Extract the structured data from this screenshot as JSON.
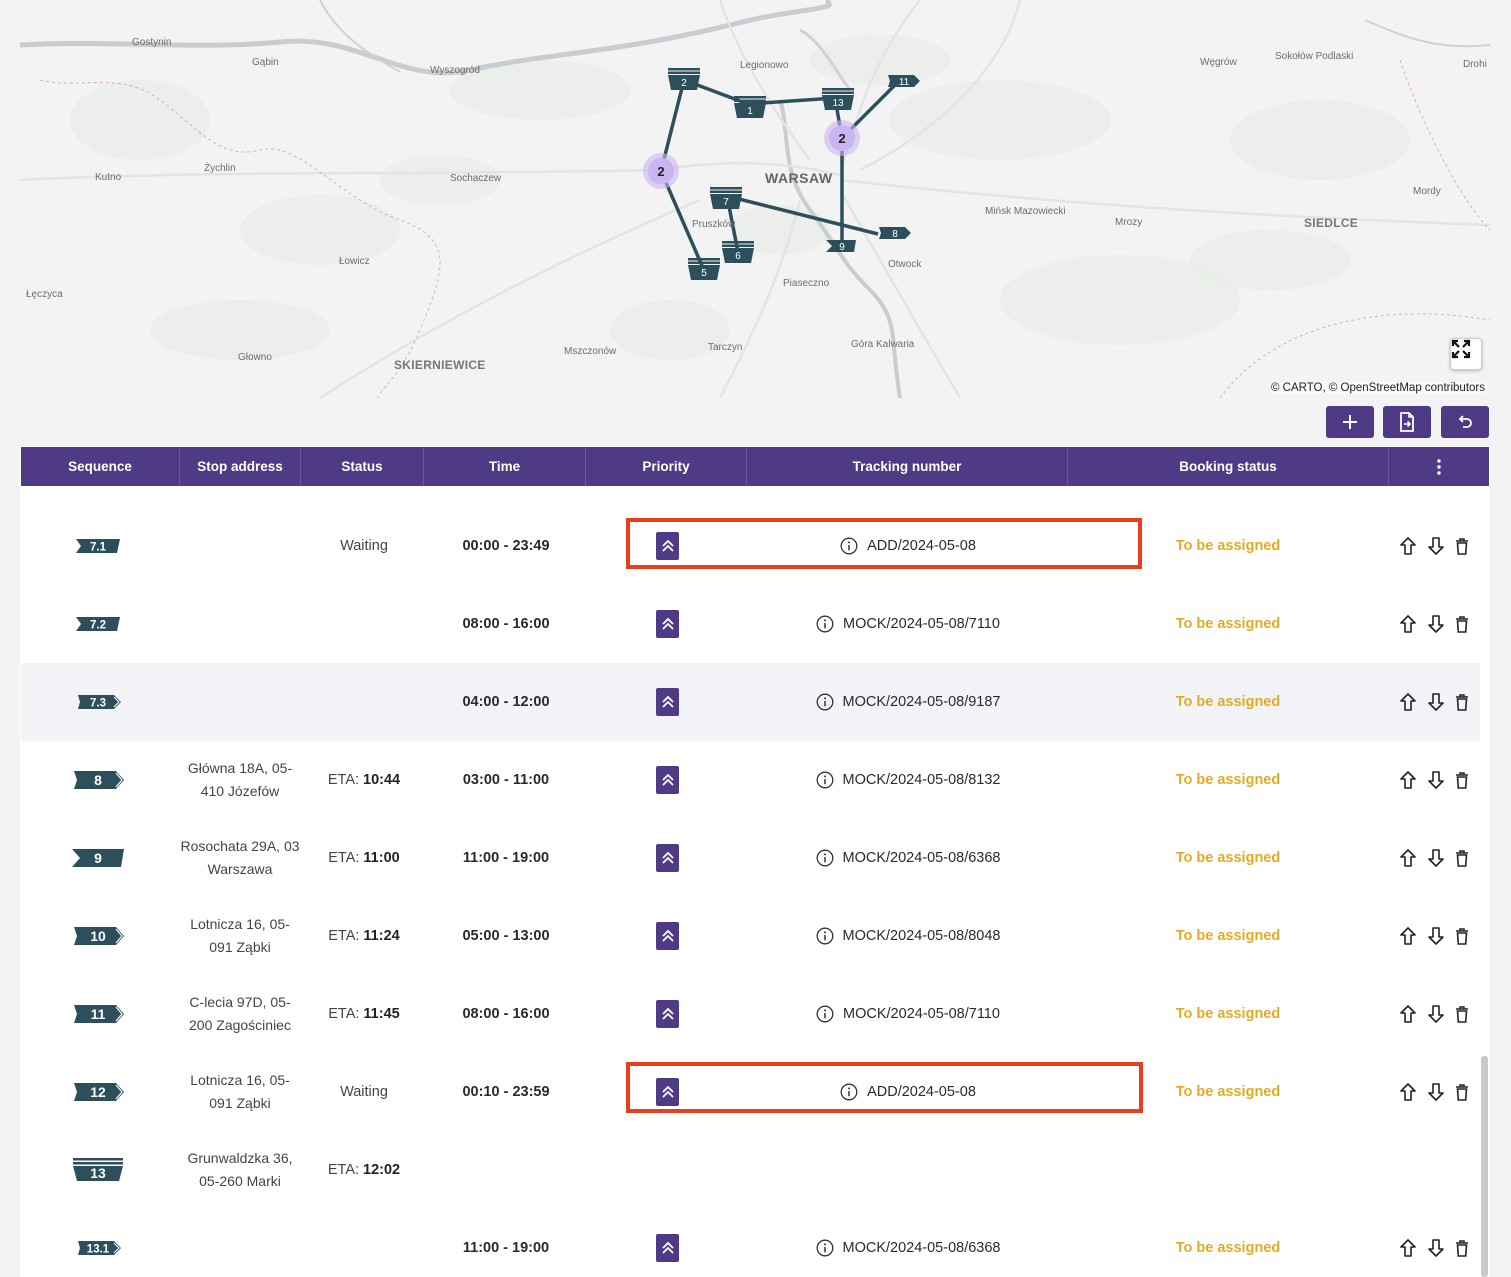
{
  "map": {
    "attribution": "© CARTO, © OpenStreetMap contributors",
    "places": [
      {
        "name": "Gostynin",
        "cls": ""
      },
      {
        "name": "Gąbin",
        "cls": ""
      },
      {
        "name": "Wyszogród",
        "cls": ""
      },
      {
        "name": "Legionowo",
        "cls": ""
      },
      {
        "name": "Węgrów",
        "cls": ""
      },
      {
        "name": "Sokołów Podlaski",
        "cls": ""
      },
      {
        "name": "Drohi",
        "cls": ""
      },
      {
        "name": "Kutno",
        "cls": ""
      },
      {
        "name": "Żychlin",
        "cls": ""
      },
      {
        "name": "Sochaczew",
        "cls": ""
      },
      {
        "name": "WARSAW",
        "cls": "capital"
      },
      {
        "name": "Mińsk Mazowiecki",
        "cls": ""
      },
      {
        "name": "Mrozy",
        "cls": ""
      },
      {
        "name": "Mordy",
        "cls": ""
      },
      {
        "name": "SIEDLCE",
        "cls": "big"
      },
      {
        "name": "Pruszków",
        "cls": ""
      },
      {
        "name": "Łowicz",
        "cls": ""
      },
      {
        "name": "Otwock",
        "cls": ""
      },
      {
        "name": "Łęczyca",
        "cls": ""
      },
      {
        "name": "Piaseczno",
        "cls": ""
      },
      {
        "name": "Tarczyn",
        "cls": ""
      },
      {
        "name": "Góra Kalwaria",
        "cls": ""
      },
      {
        "name": "Mszczonów",
        "cls": ""
      },
      {
        "name": "Głowno",
        "cls": ""
      },
      {
        "name": "SKIERNIEWICE",
        "cls": "big"
      }
    ],
    "markers": [
      "2",
      "1",
      "13",
      "11",
      "7",
      "8",
      "9",
      "6",
      "5"
    ],
    "clusters": [
      "2",
      "2"
    ],
    "colors": {
      "route": "#2d4f5c",
      "marker": "#2d4f5c",
      "cluster": "#c9b5f0"
    }
  },
  "toolbar": {
    "add": "plus-icon",
    "export": "file-export-icon",
    "undo": "undo-icon"
  },
  "table": {
    "columns": [
      "Sequence",
      "Stop address",
      "Status",
      "Time",
      "Priority",
      "Tracking number",
      "Booking status"
    ],
    "menu_icon": "more-vertical-icon",
    "rows": [
      {
        "seq": "7.1",
        "marker": "sub-in",
        "address": "",
        "status": "Waiting",
        "eta": "",
        "time": "00:00 - 23:49",
        "priority": true,
        "tracking": "ADD/2024-05-08",
        "booking": "To be assigned",
        "shaded": false
      },
      {
        "seq": "7.2",
        "marker": "sub-in",
        "address": "",
        "status": "",
        "eta": "",
        "time": "08:00 - 16:00",
        "priority": true,
        "tracking": "MOCK/2024-05-08/7110",
        "booking": "To be assigned",
        "shaded": false
      },
      {
        "seq": "7.3",
        "marker": "sub-out",
        "address": "",
        "status": "",
        "eta": "",
        "time": "04:00 - 12:00",
        "priority": true,
        "tracking": "MOCK/2024-05-08/9187",
        "booking": "To be assigned",
        "shaded": true
      },
      {
        "seq": "8",
        "marker": "out",
        "address": "Główna 18A, 05-410 Józefów",
        "status": "ETA:",
        "eta": "10:44",
        "time": "03:00 - 11:00",
        "priority": true,
        "tracking": "MOCK/2024-05-08/8132",
        "booking": "To be assigned",
        "shaded": false
      },
      {
        "seq": "9",
        "marker": "in",
        "address": "Rosochata 29A, 03 Warszawa",
        "status": "ETA:",
        "eta": "11:00",
        "time": "11:00 - 19:00",
        "priority": true,
        "tracking": "MOCK/2024-05-08/6368",
        "booking": "To be assigned",
        "shaded": false
      },
      {
        "seq": "10",
        "marker": "out",
        "address": "Lotnicza 16, 05-091 Ząbki",
        "status": "ETA:",
        "eta": "11:24",
        "time": "05:00 - 13:00",
        "priority": true,
        "tracking": "MOCK/2024-05-08/8048",
        "booking": "To be assigned",
        "shaded": false
      },
      {
        "seq": "11",
        "marker": "out",
        "address": "C-lecia 97D, 05-200 Zagościniec",
        "status": "ETA:",
        "eta": "11:45",
        "time": "08:00 - 16:00",
        "priority": true,
        "tracking": "MOCK/2024-05-08/7110",
        "booking": "To be assigned",
        "shaded": false
      },
      {
        "seq": "12",
        "marker": "out",
        "address": "Lotnicza 16, 05-091 Ząbki",
        "status": "Waiting",
        "eta": "",
        "time": "00:10 - 23:59",
        "priority": true,
        "tracking": "ADD/2024-05-08",
        "booking": "To be assigned",
        "shaded": false
      },
      {
        "seq": "13",
        "marker": "stack",
        "address": "Grunwaldzka 36, 05-260 Marki",
        "status": "ETA:",
        "eta": "12:02",
        "time": "",
        "priority": false,
        "tracking": "",
        "booking": "",
        "shaded": false
      },
      {
        "seq": "13.1",
        "marker": "sub-out",
        "address": "",
        "status": "",
        "eta": "",
        "time": "11:00 - 19:00",
        "priority": true,
        "tracking": "MOCK/2024-05-08/6368",
        "booking": "To be assigned",
        "shaded": false
      }
    ],
    "row_actions": [
      "arrow-up-icon",
      "arrow-down-icon",
      "trash-icon"
    ],
    "highlighted_rows": [
      0,
      7
    ]
  }
}
